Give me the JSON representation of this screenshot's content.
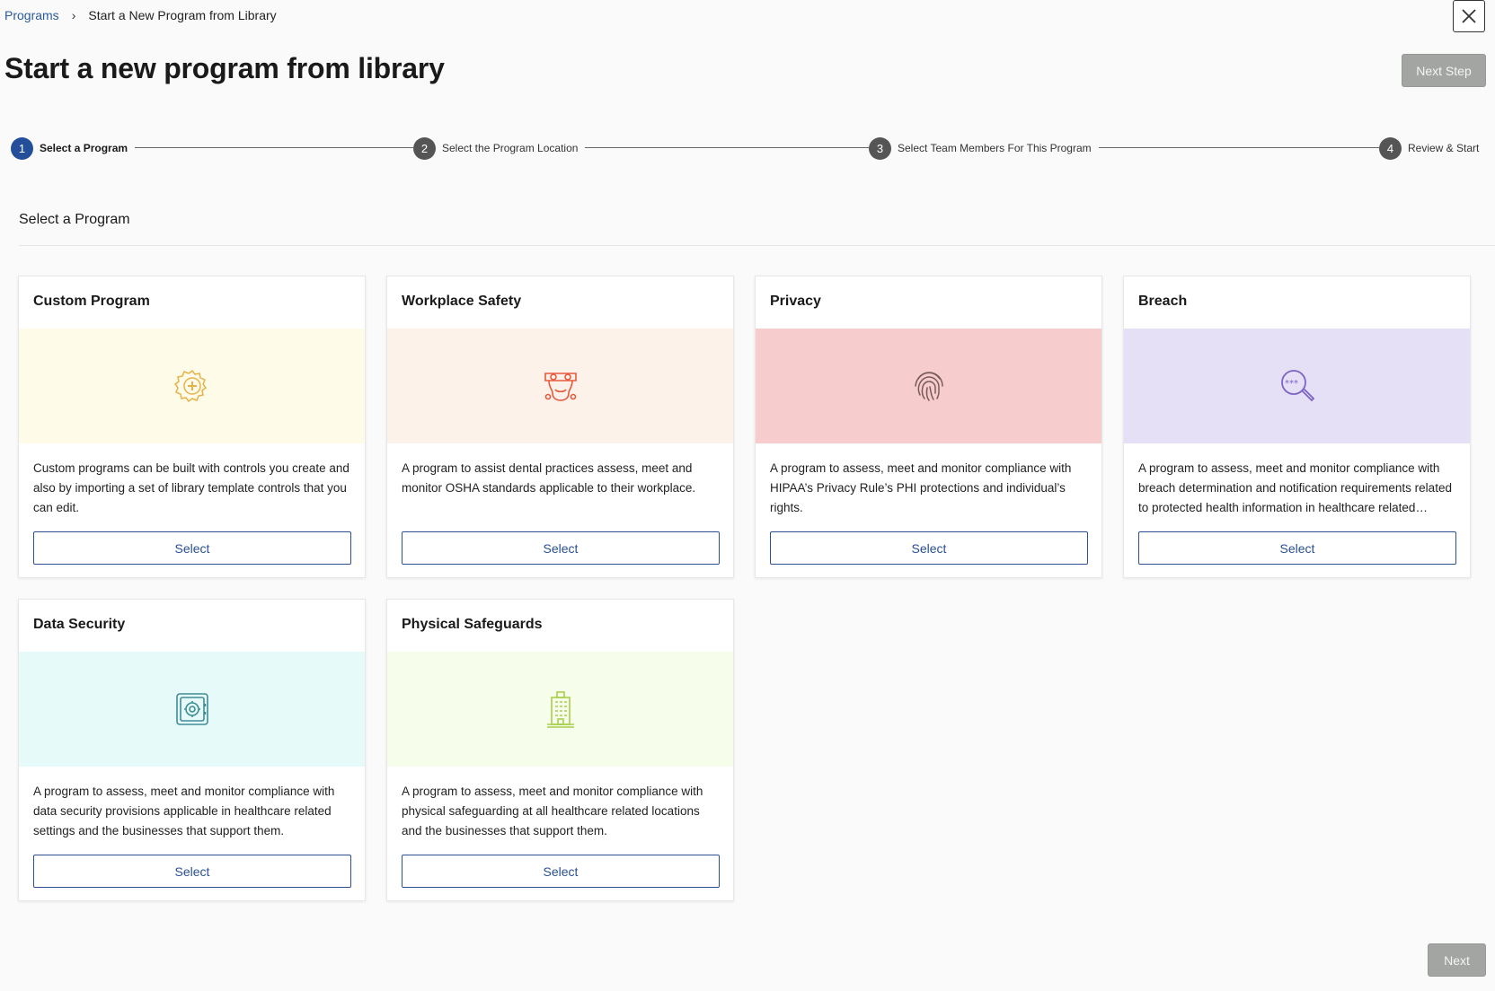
{
  "breadcrumb": {
    "root": "Programs",
    "separator": "›",
    "current": "Start a New Program from Library"
  },
  "header": {
    "title": "Start a new program from library",
    "next_step_label": "Next Step",
    "close_icon": "close-icon"
  },
  "stepper": {
    "steps": [
      {
        "num": "1",
        "label": "Select a Program",
        "active": true
      },
      {
        "num": "2",
        "label": "Select the Program Location",
        "active": false
      },
      {
        "num": "3",
        "label": "Select Team Members For This Program",
        "active": false
      },
      {
        "num": "4",
        "label": "Review & Start",
        "active": false
      }
    ]
  },
  "section": {
    "title": "Select a Program"
  },
  "cards": [
    {
      "title": "Custom Program",
      "icon": "gear-plus-icon",
      "banner_color": "#fefbe8",
      "icon_color": "#e7b24a",
      "description": "Custom programs can be built with controls you create and also by importing a set of library template controls that you can edit.",
      "button": "Select"
    },
    {
      "title": "Workplace Safety",
      "icon": "safety-mask-icon",
      "banner_color": "#fdf2ea",
      "icon_color": "#e8593c",
      "description": "A program to assist dental practices assess, meet and monitor OSHA standards applicable to their workplace.",
      "button": "Select"
    },
    {
      "title": "Privacy",
      "icon": "fingerprint-icon",
      "banner_color": "#f6cccd",
      "icon_color": "#7a5a5a",
      "description": "A program to assess, meet and monitor compliance with HIPAA’s Privacy Rule’s PHI protections and individual’s rights.",
      "button": "Select"
    },
    {
      "title": "Breach",
      "icon": "magnifier-password-icon",
      "banner_color": "#e6e0f7",
      "icon_color": "#7e63c4",
      "description": "A program to assess, meet and monitor compliance with breach determination and notification requirements related to protected health information in healthcare related settings.",
      "button": "Select"
    },
    {
      "title": "Data Security",
      "icon": "safe-vault-icon",
      "banner_color": "#e7fafa",
      "icon_color": "#3e8c94",
      "description": "A program to assess, meet and monitor compliance with data security provisions applicable in healthcare related settings and the businesses that support them.",
      "button": "Select"
    },
    {
      "title": "Physical Safeguards",
      "icon": "building-icon",
      "banner_color": "#f6fdea",
      "icon_color": "#a9cf4c",
      "description": "A program to assess, meet and monitor compliance with physical safeguarding at all healthcare related locations and the businesses that support them.",
      "button": "Select"
    }
  ],
  "footer": {
    "next_label": "Next"
  }
}
